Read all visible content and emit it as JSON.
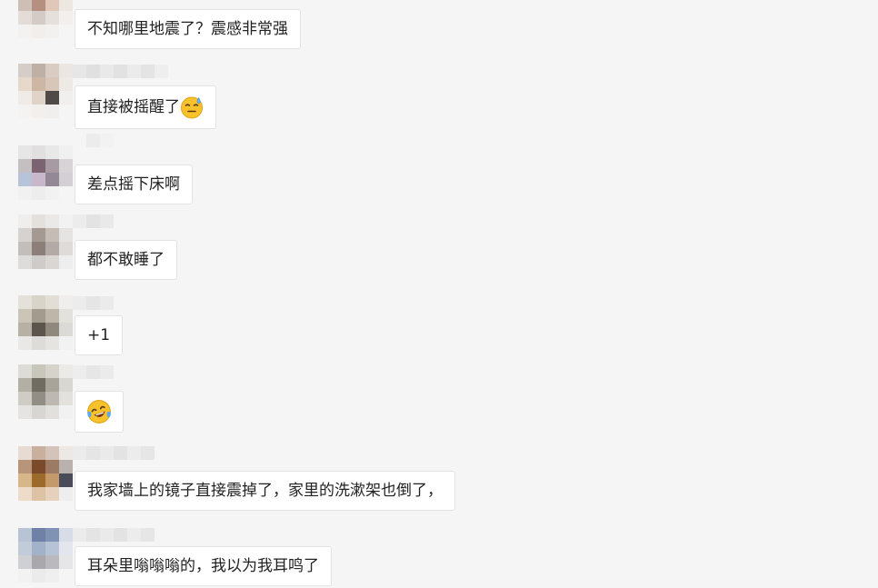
{
  "messages": [
    {
      "text": "不知哪里地震了？震感非常强"
    },
    {
      "text": "直接被摇醒了",
      "emoji": "sweat-smile-emoji"
    },
    {
      "text": "差点摇下床啊"
    },
    {
      "text": "都不敢睡了"
    },
    {
      "text": "+1"
    },
    {
      "text": "",
      "emoji": "laughing-crying-emoji"
    },
    {
      "text": "我家墙上的镜子直接震掉了，家里的洗漱架也倒了，"
    },
    {
      "text": "耳朵里嗡嗡嗡的，我以为我耳鸣了"
    }
  ],
  "colors": {
    "background": "#f5f5f5",
    "bubble": "#ffffff",
    "bubble_border": "#e3e3e3",
    "text": "#222222",
    "emoji_yellow": "#f7c22c"
  }
}
